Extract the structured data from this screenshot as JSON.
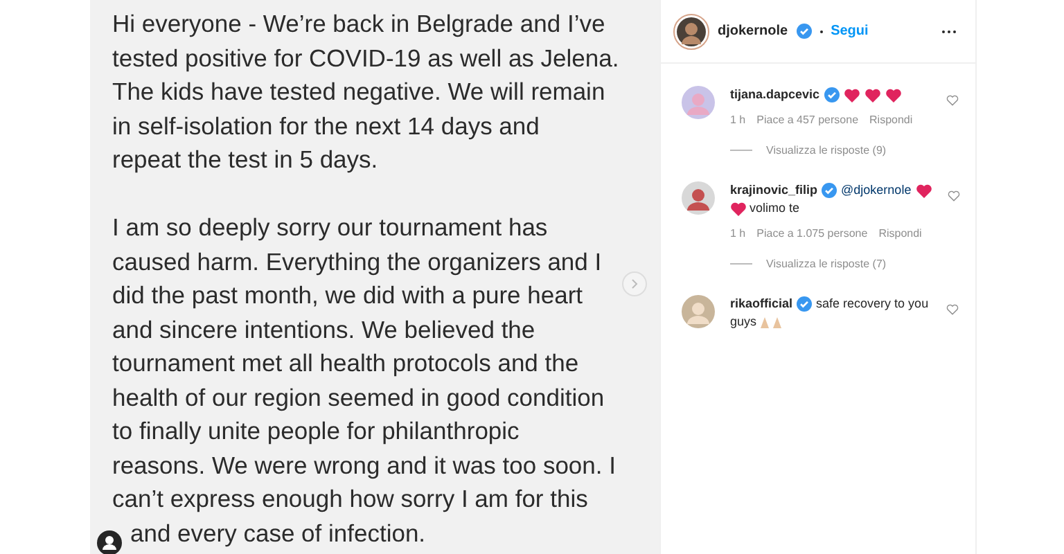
{
  "post": {
    "paragraphs": [
      [
        "Hi everyone - We’re back in Belgrade and I’ve",
        "tested positive for COVID-19 as well as Jelena.",
        "The kids have tested negative. We will remain",
        "in self-isolation for the next 14 days and",
        "repeat the test in 5 days."
      ],
      [
        "I am so deeply sorry our tournament has",
        "caused harm. Everything the organizers and I",
        "did the past month, we did with a pure heart",
        "and sincere intentions. We believed the",
        "tournament met all health protocols and the",
        "health of our region seemed in good condition",
        "to finally unite people for philanthropic",
        "reasons. We were wrong and it was too soon. I",
        "can’t express enough how sorry I am for this",
        "and every case of infection."
      ]
    ]
  },
  "header": {
    "username": "djokernole",
    "verified": true,
    "follow": "Segui"
  },
  "comments": [
    {
      "kind": "hearts",
      "username": "tijana.dapcevic",
      "verified": true,
      "time": "1 h",
      "likes": "Piace a 457 persone",
      "reply": "Rispondi",
      "view_replies": "Visualizza le risposte (9)"
    },
    {
      "kind": "mention",
      "username": "krajinovic_filip",
      "verified": true,
      "mention": "@djokernole",
      "second_line": "volimo te",
      "time": "1 h",
      "likes": "Piace a 1.075 persone",
      "reply": "Rispondi",
      "view_replies": "Visualizza le risposte (7)"
    },
    {
      "kind": "text",
      "username": "rikaofficial",
      "verified": true,
      "text": "safe recovery to you",
      "second_line": "guys"
    }
  ]
}
